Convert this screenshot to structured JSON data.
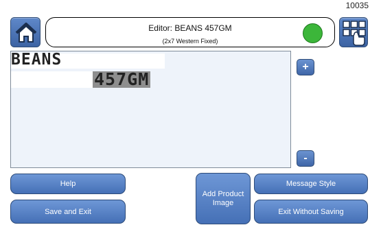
{
  "header": {
    "id_code": "10035",
    "title": "Editor: BEANS 457GM",
    "subtitle": "(2x7 Western Fixed)",
    "status_color": "#3cb63a",
    "home_icon": "home-icon",
    "menu_icon": "grid-touch-icon"
  },
  "editor": {
    "line1": "BEANS",
    "line2": "457GM",
    "plus_label": "+",
    "minus_label": "-"
  },
  "buttons": {
    "help": "Help",
    "save_exit": "Save and Exit",
    "add_product_image": "Add Product Image",
    "message_style": "Message Style",
    "exit_without_saving": "Exit Without Saving"
  }
}
